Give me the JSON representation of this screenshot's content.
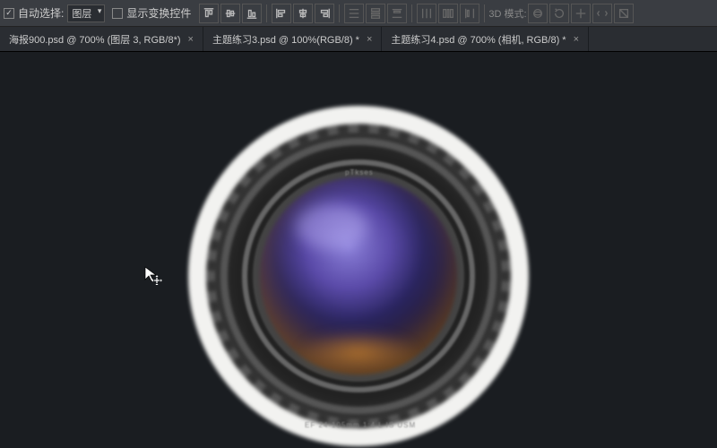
{
  "toolbar": {
    "auto_select_checked": true,
    "auto_select_label": "自动选择:",
    "auto_select_mode": "图层",
    "transform_controls_checked": false,
    "transform_controls_label": "显示变换控件",
    "mode_3d_label": "3D 模式:"
  },
  "tabs": [
    {
      "label": "海报900.psd @ 700% (图层 3, RGB/8*)",
      "close": "×"
    },
    {
      "label": "主题练习3.psd @ 100%(RGB/8) *",
      "close": "×"
    },
    {
      "label": "主题练习4.psd @ 700% (相机, RGB/8) *",
      "close": "×"
    }
  ],
  "canvas_image": {
    "brand_text_top": "pTkses",
    "ring_text": "EF 24-105mm 1:4 L IS USM"
  }
}
